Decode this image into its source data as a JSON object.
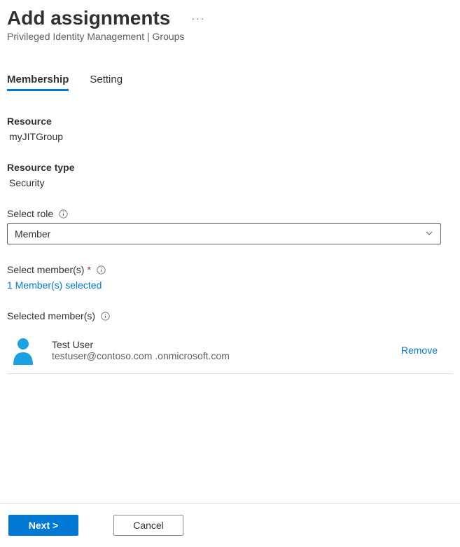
{
  "header": {
    "title": "Add assignments",
    "breadcrumb": "Privileged Identity Management | Groups"
  },
  "tabs": {
    "membership": "Membership",
    "setting": "Setting"
  },
  "form": {
    "resource_label": "Resource",
    "resource_value": "myJITGroup",
    "resource_type_label": "Resource type",
    "resource_type_value": "Security",
    "select_role_label": "Select role",
    "select_role_value": "Member",
    "select_members_label": "Select member(s)",
    "members_selected_link": "1 Member(s) selected",
    "selected_members_label": "Selected member(s)"
  },
  "members": {
    "0": {
      "name": "Test User",
      "email": "testuser@contoso.com .onmicrosoft.com",
      "remove": "Remove"
    }
  },
  "footer": {
    "next": "Next >",
    "cancel": "Cancel"
  }
}
